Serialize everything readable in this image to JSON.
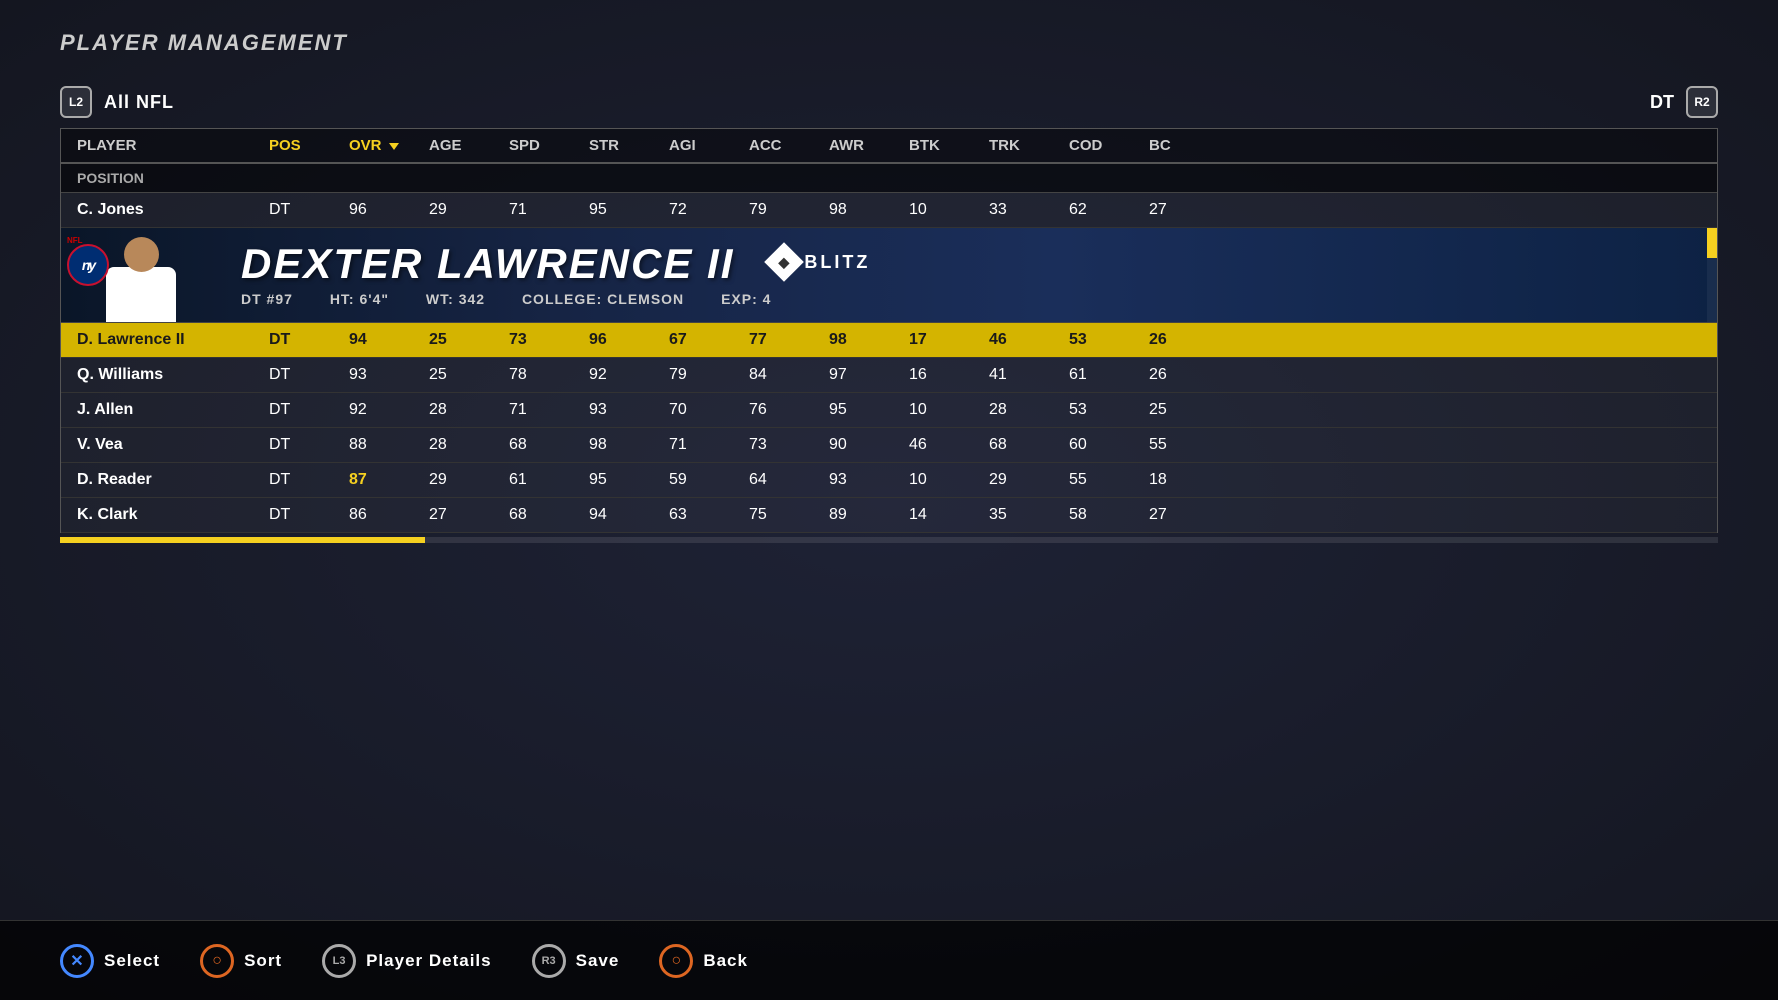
{
  "page": {
    "title": "PLAYER MANAGEMENT"
  },
  "header": {
    "l2_label": "L2",
    "r2_label": "R2",
    "filter_label": "All NFL",
    "position_label": "DT"
  },
  "columns": [
    {
      "key": "player",
      "label": "PLAYER",
      "active": false
    },
    {
      "key": "pos",
      "label": "POS",
      "active": true
    },
    {
      "key": "ovr",
      "label": "OVR",
      "active": true,
      "sorted": true
    },
    {
      "key": "age",
      "label": "AGE",
      "active": false
    },
    {
      "key": "spd",
      "label": "SPD",
      "active": false
    },
    {
      "key": "str",
      "label": "STR",
      "active": false
    },
    {
      "key": "agi",
      "label": "AGI",
      "active": false
    },
    {
      "key": "acc",
      "label": "ACC",
      "active": false
    },
    {
      "key": "awr",
      "label": "AWR",
      "active": false
    },
    {
      "key": "btk",
      "label": "BTK",
      "active": false
    },
    {
      "key": "trk",
      "label": "TRK",
      "active": false
    },
    {
      "key": "cod",
      "label": "COD",
      "active": false
    },
    {
      "key": "bc",
      "label": "BC",
      "active": false
    }
  ],
  "position_group": "POSITION",
  "selected_player": {
    "name": "DEXTER LAWRENCE II",
    "position": "DT",
    "number": "97",
    "height": "6'4\"",
    "weight": "342",
    "college": "CLEMSON",
    "exp": "4",
    "special_ability": "BLITZ",
    "team": "NY Giants"
  },
  "players": [
    {
      "name": "C. Jones",
      "pos": "DT",
      "ovr": "96",
      "age": "29",
      "spd": "71",
      "str": "95",
      "agi": "72",
      "acc": "79",
      "awr": "98",
      "btk": "10",
      "trk": "33",
      "cod": "62",
      "bc": "27",
      "selected": false,
      "highlighted": false
    },
    {
      "name": "D. Lawrence II",
      "pos": "DT",
      "ovr": "94",
      "age": "25",
      "spd": "73",
      "str": "96",
      "agi": "67",
      "acc": "77",
      "awr": "98",
      "btk": "17",
      "trk": "46",
      "cod": "53",
      "bc": "26",
      "selected": true,
      "highlighted": true
    },
    {
      "name": "Q. Williams",
      "pos": "DT",
      "ovr": "93",
      "age": "25",
      "spd": "78",
      "str": "92",
      "agi": "79",
      "acc": "84",
      "awr": "97",
      "btk": "16",
      "trk": "41",
      "cod": "61",
      "bc": "26",
      "selected": false,
      "highlighted": false
    },
    {
      "name": "J. Allen",
      "pos": "DT",
      "ovr": "92",
      "age": "28",
      "spd": "71",
      "str": "93",
      "agi": "70",
      "acc": "76",
      "awr": "95",
      "btk": "10",
      "trk": "28",
      "cod": "53",
      "bc": "25",
      "selected": false,
      "highlighted": false
    },
    {
      "name": "V. Vea",
      "pos": "DT",
      "ovr": "88",
      "age": "28",
      "spd": "68",
      "str": "98",
      "agi": "71",
      "acc": "73",
      "awr": "90",
      "btk": "46",
      "trk": "68",
      "cod": "60",
      "bc": "55",
      "selected": false,
      "highlighted": false
    },
    {
      "name": "D. Reader",
      "pos": "DT",
      "ovr": "87",
      "age": "29",
      "spd": "61",
      "str": "95",
      "agi": "59",
      "acc": "64",
      "awr": "93",
      "btk": "10",
      "trk": "29",
      "cod": "55",
      "bc": "18",
      "selected": false,
      "highlighted": false
    },
    {
      "name": "K. Clark",
      "pos": "DT",
      "ovr": "86",
      "age": "27",
      "spd": "68",
      "str": "94",
      "agi": "63",
      "acc": "75",
      "awr": "89",
      "btk": "14",
      "trk": "35",
      "cod": "58",
      "bc": "27",
      "selected": false,
      "highlighted": false
    }
  ],
  "bottom_controls": [
    {
      "button": "✕",
      "button_type": "x",
      "label": "Select"
    },
    {
      "button": "○",
      "button_type": "circle",
      "label": "Sort"
    },
    {
      "button": "L3",
      "button_type": "l3",
      "label": "Player Details"
    },
    {
      "button": "R3",
      "button_type": "r3",
      "label": "Save"
    },
    {
      "button": "○",
      "button_type": "circle2",
      "label": "Back"
    }
  ]
}
